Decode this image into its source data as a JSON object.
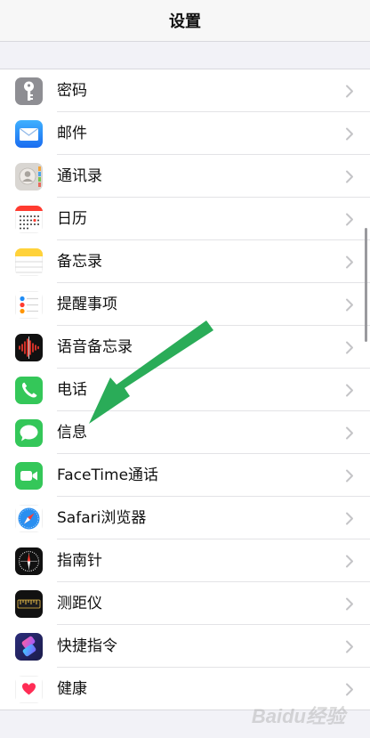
{
  "header": {
    "title": "设置"
  },
  "items": [
    {
      "label": "密码",
      "icon": "key-icon"
    },
    {
      "label": "邮件",
      "icon": "mail-icon"
    },
    {
      "label": "通讯录",
      "icon": "contacts-icon"
    },
    {
      "label": "日历",
      "icon": "calendar-icon"
    },
    {
      "label": "备忘录",
      "icon": "notes-icon"
    },
    {
      "label": "提醒事项",
      "icon": "reminders-icon"
    },
    {
      "label": "语音备忘录",
      "icon": "voice-memos-icon"
    },
    {
      "label": "电话",
      "icon": "phone-icon"
    },
    {
      "label": "信息",
      "icon": "messages-icon"
    },
    {
      "label": "FaceTime通话",
      "icon": "facetime-icon"
    },
    {
      "label": "Safari浏览器",
      "icon": "safari-icon"
    },
    {
      "label": "指南针",
      "icon": "compass-icon"
    },
    {
      "label": "测距仪",
      "icon": "measure-icon"
    },
    {
      "label": "快捷指令",
      "icon": "shortcuts-icon"
    },
    {
      "label": "健康",
      "icon": "health-icon"
    }
  ],
  "colors": {
    "accent_arrow": "#1fa84f",
    "mail": "#1f8cf5",
    "phone": "#34c759",
    "messages": "#34c759",
    "facetime": "#34c759"
  },
  "watermark": {
    "text": "Baidu经验"
  }
}
